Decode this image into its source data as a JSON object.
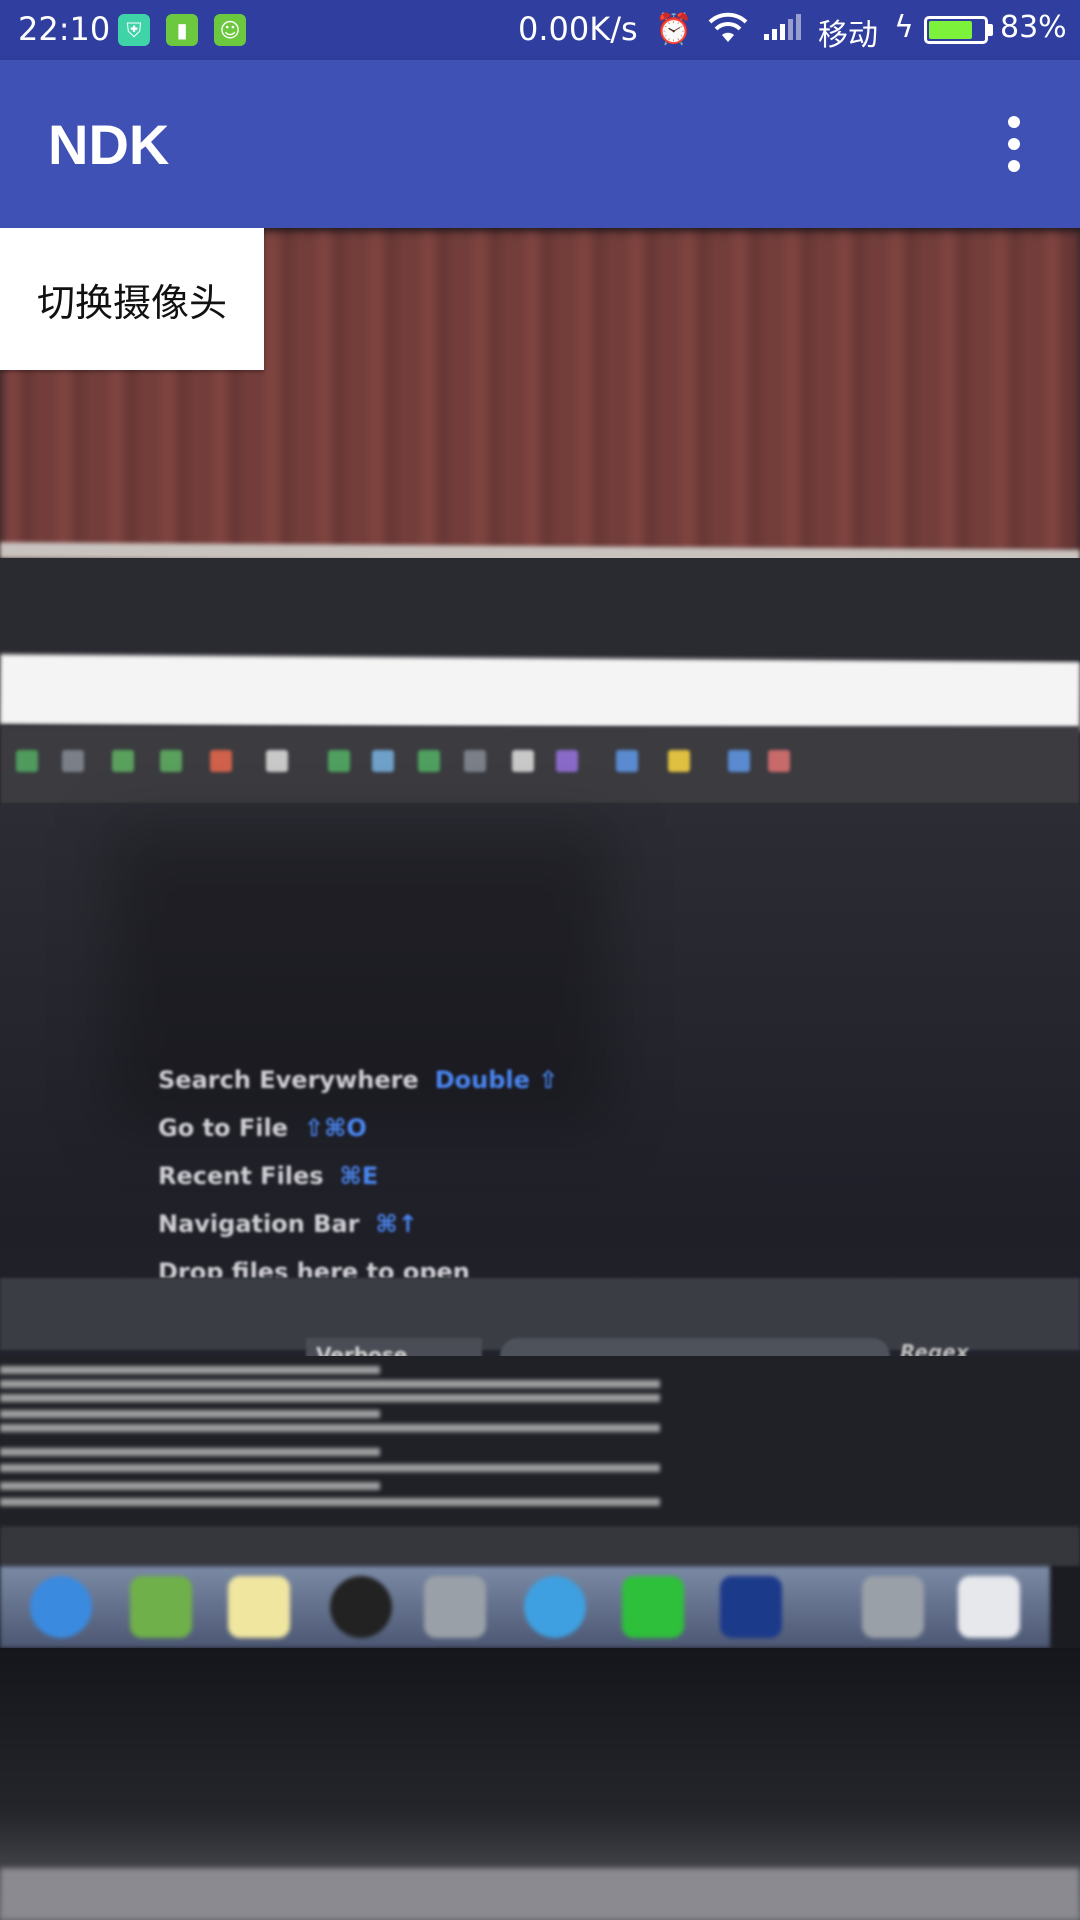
{
  "status_bar": {
    "time": "22:10",
    "notification_icons": [
      "shield-icon",
      "battery-app-icon",
      "android-icon"
    ],
    "network_speed": "0.00K/s",
    "icons": [
      "alarm-icon",
      "wifi-icon",
      "signal-icon",
      "charging-icon"
    ],
    "carrier": "移动",
    "battery_percent": "83%",
    "battery_level": 0.83
  },
  "app_bar": {
    "title": "NDK",
    "overflow_icon": "more-vert-icon",
    "background_color": "#3f51b5",
    "status_bar_color": "#303f9f"
  },
  "controls": {
    "switch_camera_label": "切换摄像头"
  },
  "camera_preview": {
    "ide_hints": [
      {
        "label": "Search Everywhere",
        "shortcut": "Double ⇧"
      },
      {
        "label": "Go to File",
        "shortcut": "⇧⌘O"
      },
      {
        "label": "Recent Files",
        "shortcut": "⌘E"
      },
      {
        "label": "Navigation Bar",
        "shortcut": "⌘↑"
      },
      {
        "label": "Drop files here to open",
        "shortcut": ""
      }
    ],
    "log_level": "Verbose",
    "regex_label": "Regex"
  }
}
